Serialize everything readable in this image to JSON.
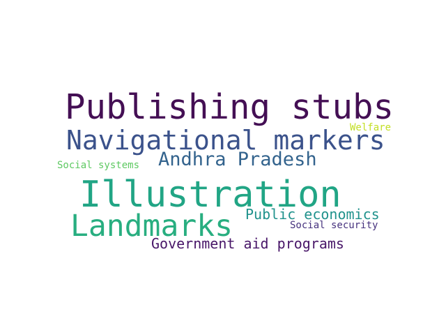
{
  "words": [
    {
      "text": "Publishing stubs",
      "color": "#440f54"
    },
    {
      "text": "Navigational markers",
      "color": "#3b528b"
    },
    {
      "text": "Welfare",
      "color": "#c2df23"
    },
    {
      "text": "Andhra Pradesh",
      "color": "#33638d"
    },
    {
      "text": "Social systems",
      "color": "#5ec962"
    },
    {
      "text": "Illustration",
      "color": "#21a585"
    },
    {
      "text": "Public economics",
      "color": "#20928c"
    },
    {
      "text": "Landmarks",
      "color": "#28ae80"
    },
    {
      "text": "Social security",
      "color": "#46327e"
    },
    {
      "text": "Government aid programs",
      "color": "#481668"
    }
  ]
}
